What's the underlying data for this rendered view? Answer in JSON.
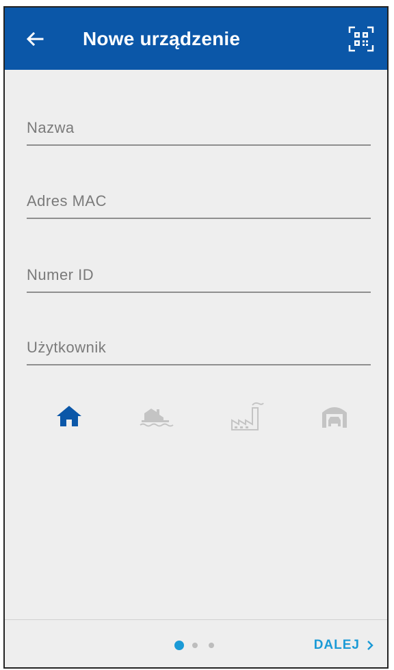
{
  "app_bar": {
    "title": "Nowe urządzenie",
    "back_icon": "arrow-left-icon",
    "qr_icon": "qr-code-scan-icon",
    "background": "#0b57a8"
  },
  "form": {
    "fields": [
      {
        "placeholder": "Nazwa",
        "value": ""
      },
      {
        "placeholder": "Adres MAC",
        "value": ""
      },
      {
        "placeholder": "Numer ID",
        "value": ""
      },
      {
        "placeholder": "Użytkownik",
        "value": ""
      }
    ]
  },
  "location_types": {
    "items": [
      {
        "icon": "home-icon",
        "selected": true
      },
      {
        "icon": "water-building-icon",
        "selected": false
      },
      {
        "icon": "factory-icon",
        "selected": false
      },
      {
        "icon": "garage-icon",
        "selected": false
      }
    ],
    "active_color": "#0b57a8",
    "inactive_color": "#c4c4c4"
  },
  "footer": {
    "pagination": {
      "current": 1,
      "total": 3
    },
    "next_label": "DALEJ",
    "next_icon": "chevron-right-icon",
    "accent": "#1a9ad6"
  }
}
